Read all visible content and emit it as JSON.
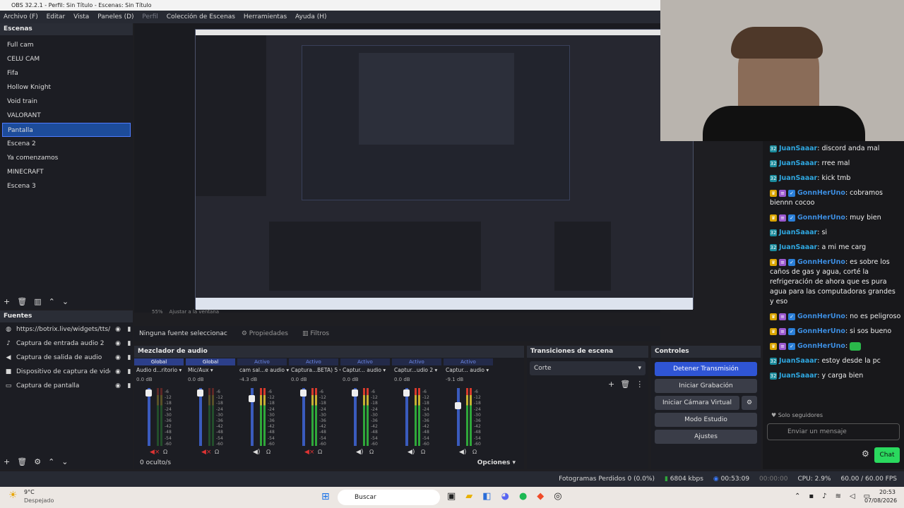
{
  "window": {
    "title": "OBS 32.2.1 - Perfil: Sin Título - Escenas: Sin Título"
  },
  "menu": [
    "Archivo (F)",
    "Editar",
    "Vista",
    "Paneles (D)",
    "Perfil",
    "Colección de Escenas",
    "Herramientas",
    "Ayuda (H)"
  ],
  "scenes": {
    "title": "Escenas",
    "items": [
      "Full cam",
      "CELU CAM",
      "Fifa",
      "Hollow Knight",
      "Void train",
      "VALORANT",
      "Pantalla",
      "Escena 2",
      "Ya comenzamos",
      "MINECRAFT",
      "Escena 3"
    ],
    "selected": "Pantalla"
  },
  "sources": {
    "title": "Fuentes",
    "items": [
      "https://botrix.live/widgets/tts/?",
      "Captura de entrada audio 2",
      "Captura de salida de audio",
      "Dispositivo de captura de video",
      "Captura de pantalla"
    ]
  },
  "preview": {
    "zoom": "55%",
    "fit": "Ajustar a la ventana"
  },
  "propbar": {
    "no_source": "Ninguna fuente seleccionac",
    "properties": "Propiedades",
    "filters": "Filtros"
  },
  "mixer": {
    "title": "Mezclador de audio",
    "footer": "0 oculto/s",
    "options": "Opciones",
    "channels": [
      {
        "status": "Global",
        "name": "Audio d...ritorio",
        "db": "0.0 dB",
        "muted": true
      },
      {
        "status": "Global",
        "name": "Mic/Aux",
        "db": "0.0 dB",
        "muted": true
      },
      {
        "status": "Activo",
        "name": "cam sal...e audio",
        "db": "-4.3 dB",
        "muted": false
      },
      {
        "status": "Activo",
        "name": "Captura...BETA) 5",
        "db": "0.0 dB",
        "muted": true
      },
      {
        "status": "Activo",
        "name": "Captur... audio",
        "db": "0.0 dB",
        "muted": false
      },
      {
        "status": "Activo",
        "name": "Captur...udio 2",
        "db": "0.0 dB",
        "muted": false
      },
      {
        "status": "Activo",
        "name": "Captur... audio",
        "db": "-9.1 dB",
        "muted": false
      }
    ],
    "scale": [
      "-6",
      "-12",
      "-18",
      "-24",
      "-30",
      "-36",
      "-42",
      "-48",
      "-54",
      "-60"
    ]
  },
  "transitions": {
    "title": "Transiciones de escena",
    "selected": "Corte"
  },
  "controls": {
    "title": "Controles",
    "buttons": [
      "Detener Transmisión",
      "Iniciar Grabación",
      "Iniciar Cámara Virtual",
      "Modo Estudio",
      "Ajustes"
    ]
  },
  "status": {
    "dropped": "Fotogramas Perdidos 0 (0.0%)",
    "bitrate": "6804 kbps",
    "live_time": "00:53:09",
    "rec_time": "00:00:00",
    "cpu": "CPU: 2.9%",
    "fps": "60.00 / 60.00 FPS"
  },
  "chat": {
    "messages": [
      {
        "user": "JuanSaaar",
        "text": "discord anda mal"
      },
      {
        "user": "JuanSaaar",
        "text": "rree mal"
      },
      {
        "user": "JuanSaaar",
        "text": "kick tmb"
      },
      {
        "user": "GonnHerUno",
        "text": "cobramos biennn cocoo"
      },
      {
        "user": "GonnHerUno",
        "text": "muy bien"
      },
      {
        "user": "JuanSaaar",
        "text": "si"
      },
      {
        "user": "JuanSaaar",
        "text": "a mi me carg"
      },
      {
        "user": "GonnHerUno",
        "text": "es sobre los caños de gas y agua, corté la refrigeración de ahora que es pura agua para las computadoras grandes y eso"
      },
      {
        "user": "GonnHerUno",
        "text": "no es peligroso"
      },
      {
        "user": "GonnHerUno",
        "text": "si sos bueno"
      },
      {
        "user": "GonnHerUno",
        "text": ""
      },
      {
        "user": "JuanSaaar",
        "text": "estoy desde la pc"
      },
      {
        "user": "JuanSaaar",
        "text": "y carga bien"
      }
    ],
    "followers_only": "Solo seguidores",
    "placeholder": "Enviar un mensaje",
    "send": "Chat"
  },
  "taskbar": {
    "temp": "9°C",
    "weather": "Despejado",
    "search": "Buscar",
    "time": "20:53",
    "date": "07/08/2026"
  }
}
